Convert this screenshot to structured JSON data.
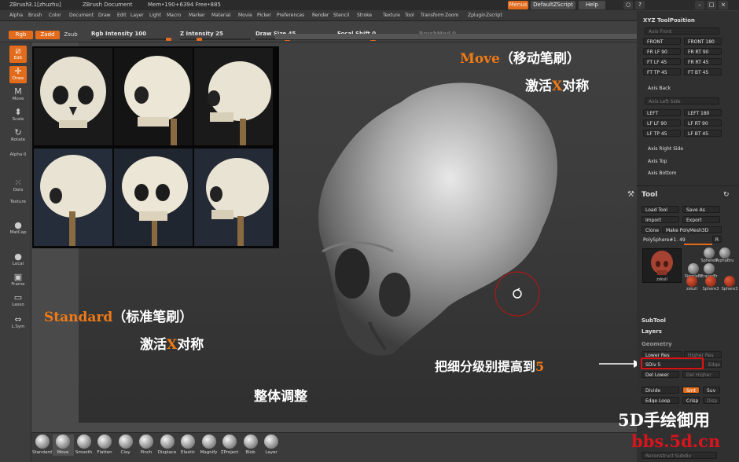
{
  "titlebar": {
    "app": "ZBrush",
    "version": "3.1[zhuzhu]",
    "document": "ZBrush Document",
    "mem": "Mem•190+6394 Free•885",
    "menus": "Menus",
    "script": "DefaultZScript",
    "help": "Help"
  },
  "menu": [
    "Alpha",
    "Brush",
    "Color",
    "Document",
    "Draw",
    "Edit",
    "Layer",
    "Light",
    "Macro",
    "Marker",
    "Material",
    "Movie",
    "Picker",
    "Preferences",
    "Render",
    "Stencil",
    "Stroke",
    "Texture",
    "Tool",
    "Transform",
    "Zoom",
    "Zplugin",
    "Zscript"
  ],
  "topshelf": {
    "rgb": "Rgb",
    "zadd": "Zadd",
    "zsub": "Zsub",
    "rgb_intensity": "Rgb Intensity 100",
    "z_intensity": "Z Intensity 25",
    "draw_size": "Draw Size 45",
    "focal_shift": "Focal Shift 0",
    "brushmod": "BrushMod 0"
  },
  "levels": {
    "rgb_intensity": 1.0,
    "z_intensity": 0.25,
    "draw_size": 0.45,
    "focal_shift": 0.5
  },
  "lefttools": [
    {
      "name": "edit",
      "icon": "edit-icon",
      "label": "Edit",
      "glyph": "⧄"
    },
    {
      "name": "draw",
      "icon": "draw-icon",
      "label": "Draw",
      "glyph": "✛"
    },
    {
      "name": "move",
      "icon": "move-icon",
      "label": "Move",
      "glyph": "M"
    },
    {
      "name": "scale",
      "icon": "scale-icon",
      "label": "Scale",
      "glyph": "⬍"
    },
    {
      "name": "rotate",
      "icon": "rotate-icon",
      "label": "Rotate",
      "glyph": "↻"
    },
    {
      "name": "alpha",
      "icon": "alpha-icon",
      "label": "Alpha  0",
      "glyph": ""
    },
    {
      "name": "dots",
      "icon": "dots-icon",
      "label": "Dots",
      "glyph": "⁙"
    },
    {
      "name": "texture",
      "icon": "texture-icon",
      "label": "Texture",
      "glyph": ""
    },
    {
      "name": "matcap",
      "icon": "matcap-icon",
      "label": "MatCap",
      "glyph": "●"
    },
    {
      "name": "local",
      "icon": "local-icon",
      "label": "Local",
      "glyph": "●"
    },
    {
      "name": "frame",
      "icon": "frame-icon",
      "label": "Frame",
      "glyph": "▣"
    },
    {
      "name": "lasso",
      "icon": "lasso-icon",
      "label": "Lasso",
      "glyph": "▭"
    },
    {
      "name": "lsym",
      "icon": "lsym-icon",
      "label": "L.Sym",
      "glyph": "⇔"
    }
  ],
  "brushes": [
    "Standard",
    "Move",
    "Smooth",
    "Flatten",
    "Clay",
    "Pinch",
    "Displace",
    "Elastic",
    "Magnify",
    "ZProject",
    "Blob",
    "Layer"
  ],
  "right": {
    "xyz_title": "XYZ ToolPosition",
    "axis_front": "Axis Front",
    "front": "FRONT",
    "front180": "FRONT 180",
    "fr_lf90": "FR LF 90",
    "fr_rt90": "FR RT 90",
    "ft_lf45": "FT LF 45",
    "fr_rt45": "FR RT 45",
    "ft_tp45": "FT TP 45",
    "ft_bt45": "FT BT 45",
    "axis_back": "Axis Back",
    "axis_left_side": "Axis Left Side",
    "left": "LEFT",
    "left180": "LEFT 180",
    "lf_lf90": "LF LF 90",
    "lf_rt90": "LF RT 90",
    "lf_tp45": "LF TP 45",
    "lf_bt45": "LF BT 45",
    "axis_right_side": "Axis Right Side",
    "axis_top": "Axis Top",
    "axis_bottom": "Axis Bottom",
    "tool_title": "Tool",
    "load_tool": "Load Tool",
    "save_as": "Save As",
    "import": "Import",
    "export": "Export",
    "clone": "Clone",
    "make_polymesh": "Make PolyMesh3D",
    "polysphere": "PolySphere#1. 49",
    "r": "R",
    "thumbs": [
      "zskull",
      "SphereB",
      "AlphaBru",
      "SimpleBr",
      "EraserBr",
      "zskull",
      "Sphere3",
      "Sphere3"
    ],
    "subtool": "SubTool",
    "layers": "Layers",
    "geometry": "Geometry",
    "lower_res": "Lower Res",
    "higher_res": "Higher Res",
    "sdiv": "SDiv 5",
    "edge": "Edge",
    "del_lower": "Del Lower",
    "del_higher": "Del Higher",
    "divide": "Divide",
    "smt": "Smt",
    "suv": "Suv",
    "edge_loop": "Edge Loop",
    "crisp": "Crisp",
    "disp": "Disp",
    "reconstruct": "Reconstruct Subdiv"
  },
  "annotations": {
    "move_en": "Move",
    "move_cn": "（移动笔刷）",
    "move_sym_a": "激活",
    "move_sym_x": "X",
    "move_sym_b": "对称",
    "standard_en": "Standard",
    "standard_cn": "（标准笔刷）",
    "std_sym_a": "激活",
    "std_sym_x": "X",
    "std_sym_b": "对称",
    "overall": "整体调整",
    "sdiv_note": "把细分级别提高到",
    "sdiv_num": "5"
  },
  "watermark": {
    "line1": "5D手绘御用",
    "line2": "bbs.5d.cn"
  },
  "colors": {
    "accent": "#e36c1c",
    "note_orange": "#f07a16",
    "watermark_red": "#d8141c",
    "highlight_box": "#e01010"
  }
}
